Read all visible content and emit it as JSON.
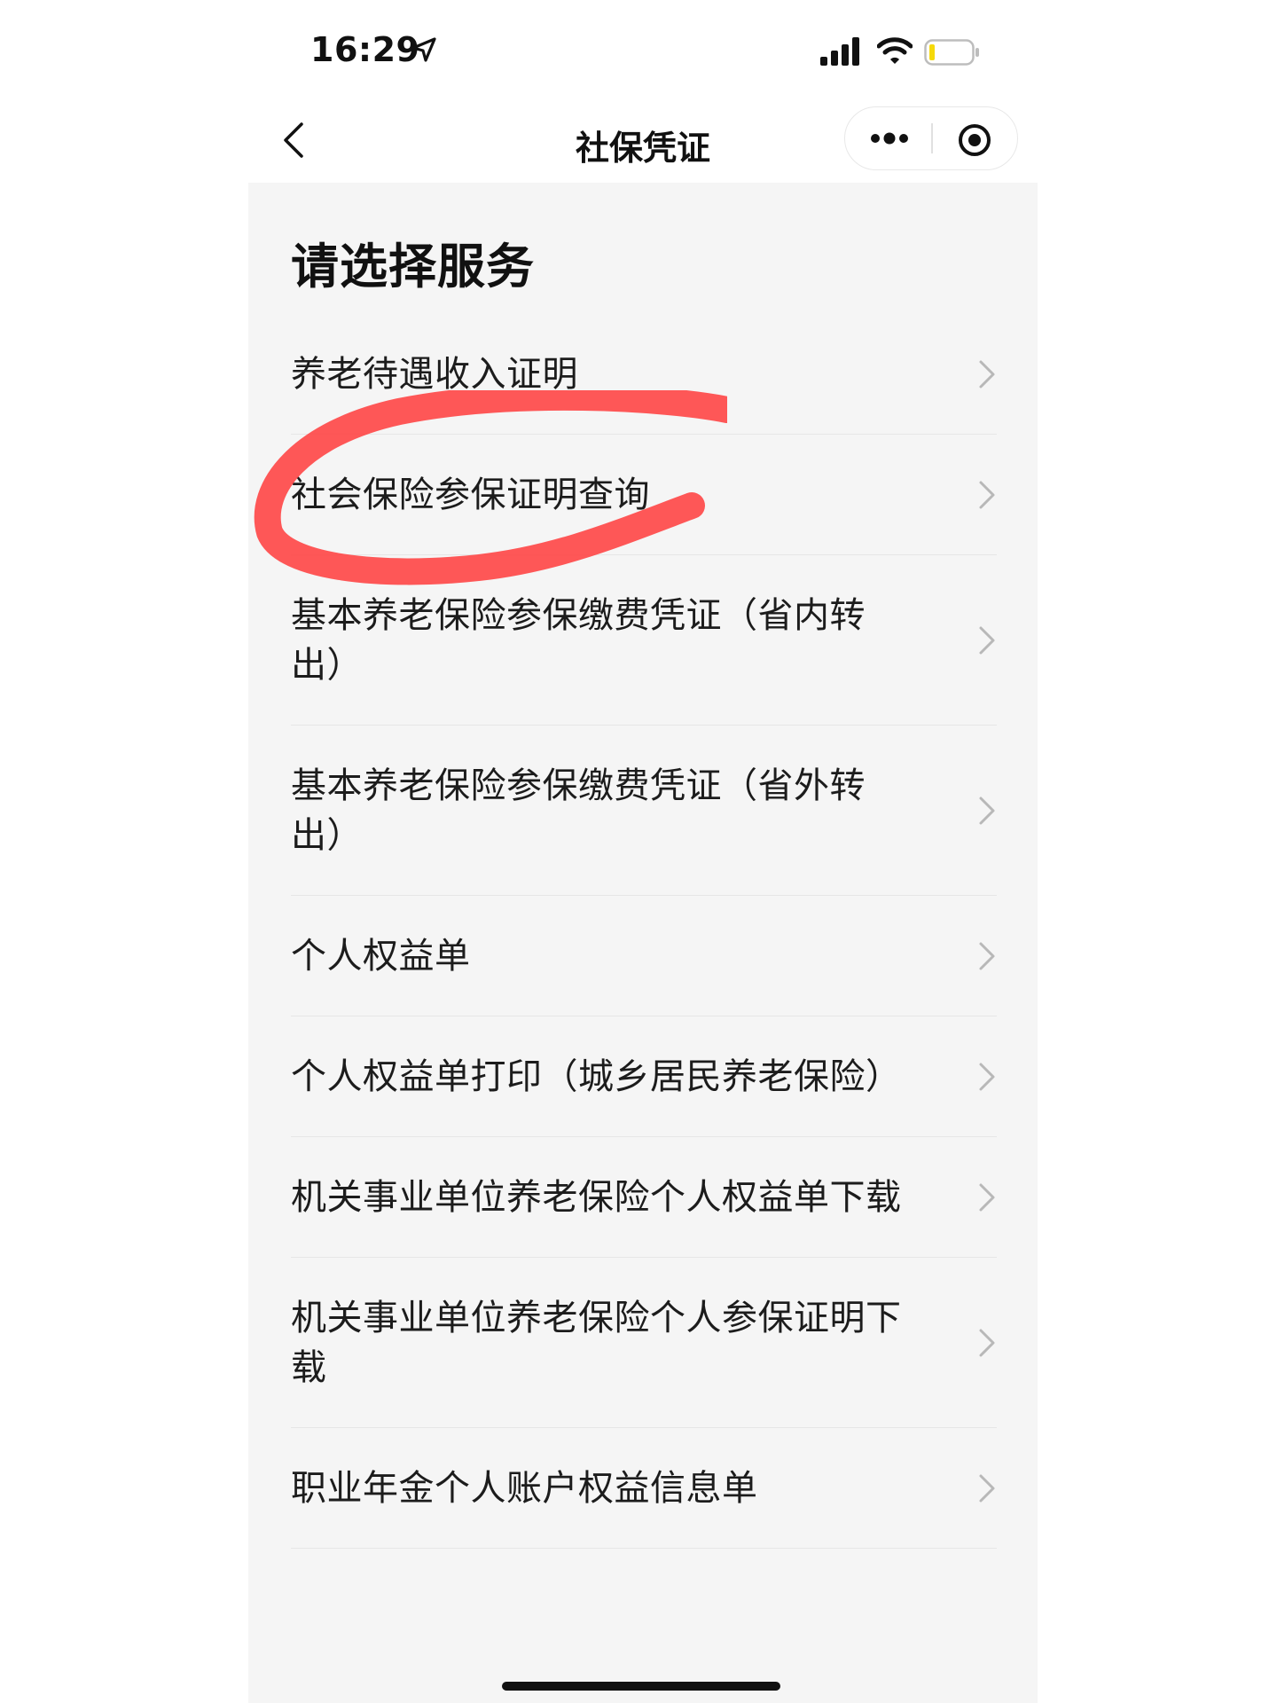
{
  "status_bar": {
    "time": "16:29"
  },
  "nav": {
    "title": "社保凭证"
  },
  "main": {
    "section_title": "请选择服务",
    "items": [
      {
        "label": "养老待遇收入证明"
      },
      {
        "label": "社会保险参保证明查询"
      },
      {
        "label": "基本养老保险参保缴费凭证（省内转出）"
      },
      {
        "label": "基本养老保险参保缴费凭证（省外转出）"
      },
      {
        "label": "个人权益单"
      },
      {
        "label": "个人权益单打印（城乡居民养老保险）"
      },
      {
        "label": "机关事业单位养老保险个人权益单下载"
      },
      {
        "label": "机关事业单位养老保险个人参保证明下载"
      },
      {
        "label": "职业年金个人账户权益信息单"
      }
    ]
  },
  "icons": {
    "status": [
      "location-icon",
      "signal-icon",
      "wifi-icon",
      "battery-icon"
    ],
    "nav": [
      "back-icon",
      "more-icon",
      "target-icon"
    ],
    "list": "chevron-right-icon"
  },
  "colors": {
    "background": "#f5f5f5",
    "marker": "#ff3b3b",
    "battery_level": "#f5d90a"
  }
}
